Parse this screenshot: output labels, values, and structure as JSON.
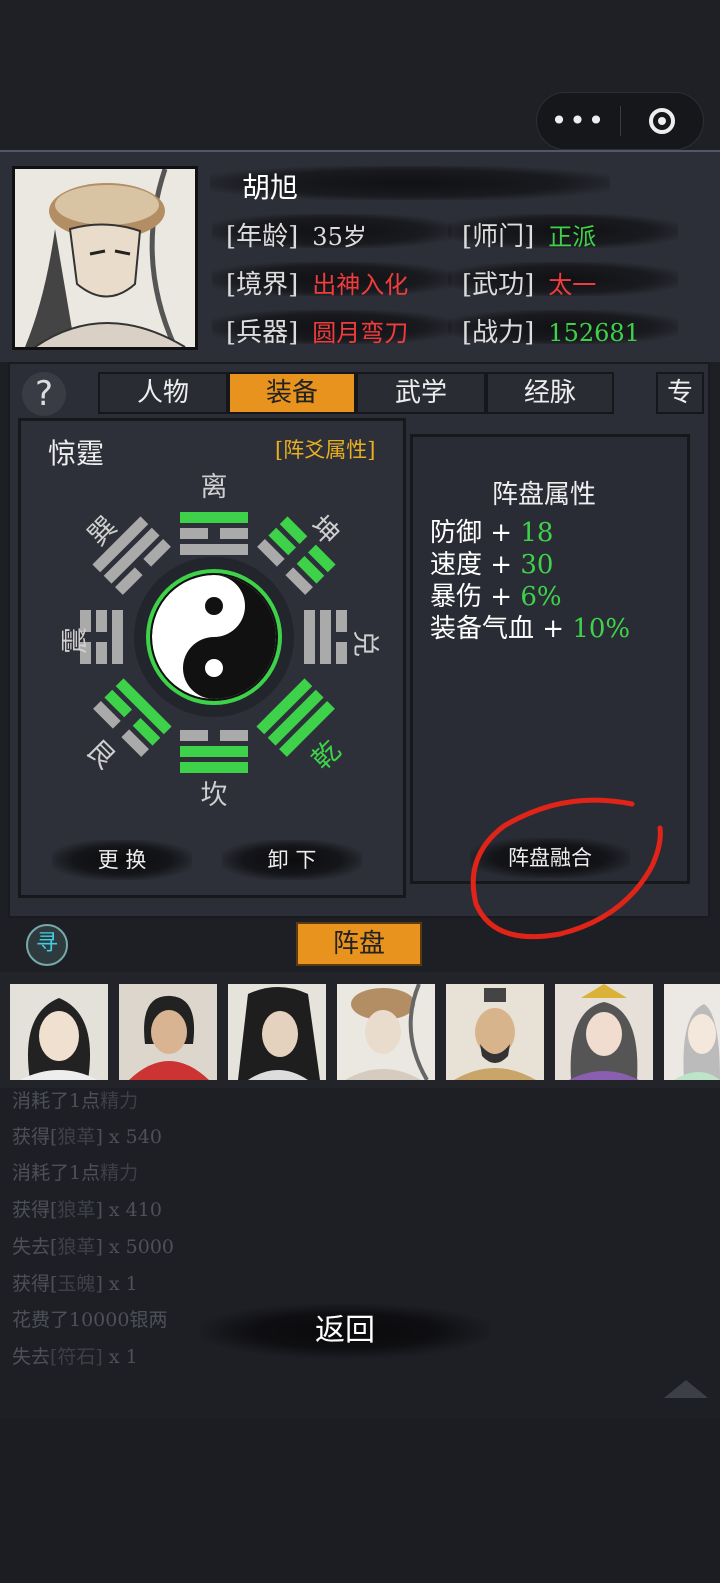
{
  "capsule": {
    "more_icon": "more-dots-icon",
    "close_icon": "target-circle-icon",
    "more_glyph": "•••"
  },
  "character": {
    "name": "胡旭",
    "fields": [
      {
        "label": "[年龄]",
        "value": "35岁",
        "color": "#dddddd"
      },
      {
        "label": "[师门]",
        "value": "正派",
        "color": "#3ed24a"
      },
      {
        "label": "[境界]",
        "value": "出神入化",
        "color": "#f03c3c"
      },
      {
        "label": "[武功]",
        "value": "太一",
        "color": "#f03c3c"
      },
      {
        "label": "[兵器]",
        "value": "圆月弯刀",
        "color": "#f03c3c"
      },
      {
        "label": "[战力]",
        "value": "152681",
        "color": "#3ed24a"
      }
    ]
  },
  "help_glyph": "?",
  "tabs": [
    "人物",
    "装备",
    "武学",
    "经脉",
    "专"
  ],
  "active_tab": "装备",
  "formation": {
    "name": "惊霆",
    "attr_link": "[阵爻属性]",
    "trigrams": {
      "li": "离",
      "kun": "坤",
      "dui": "兑",
      "qian": "乾",
      "kan": "坎",
      "gen": "艮",
      "zhen": "震",
      "xun": "巽"
    },
    "buttons": {
      "replace": "更 换",
      "unload": "卸 下"
    }
  },
  "panel_attrs": {
    "title": "阵盘属性",
    "stats": [
      {
        "name": "防御",
        "value": "18"
      },
      {
        "name": "速度",
        "value": "30"
      },
      {
        "name": "暴伤",
        "value": "6%"
      },
      {
        "name": "装备气血",
        "value": "10%"
      }
    ],
    "fuse_button": "阵盘融合"
  },
  "search_glyph": "寻",
  "zhenpan_tab": "阵盘",
  "log": [
    {
      "a": "消耗了1点",
      "b": "精力",
      "c": ""
    },
    {
      "a": "获得[",
      "b": "狼革",
      "c": "] x 540"
    },
    {
      "a": "消耗了1点",
      "b": "精力",
      "c": ""
    },
    {
      "a": "获得[",
      "b": "狼革",
      "c": "] x 410"
    },
    {
      "a": "失去[",
      "b": "狼革",
      "c": "] x 5000"
    },
    {
      "a": "获得[",
      "b": "玉魄",
      "c": "] x 1"
    },
    {
      "a": "花费了10000银两",
      "b": "",
      "c": ""
    },
    {
      "a": "失去",
      "b": "[符石]",
      "c": " x 1"
    }
  ],
  "back_button": "返回",
  "colors": {
    "accent": "#e8931d",
    "green": "#3ed24a",
    "red": "#f03c3c",
    "gold": "#e8b020"
  }
}
